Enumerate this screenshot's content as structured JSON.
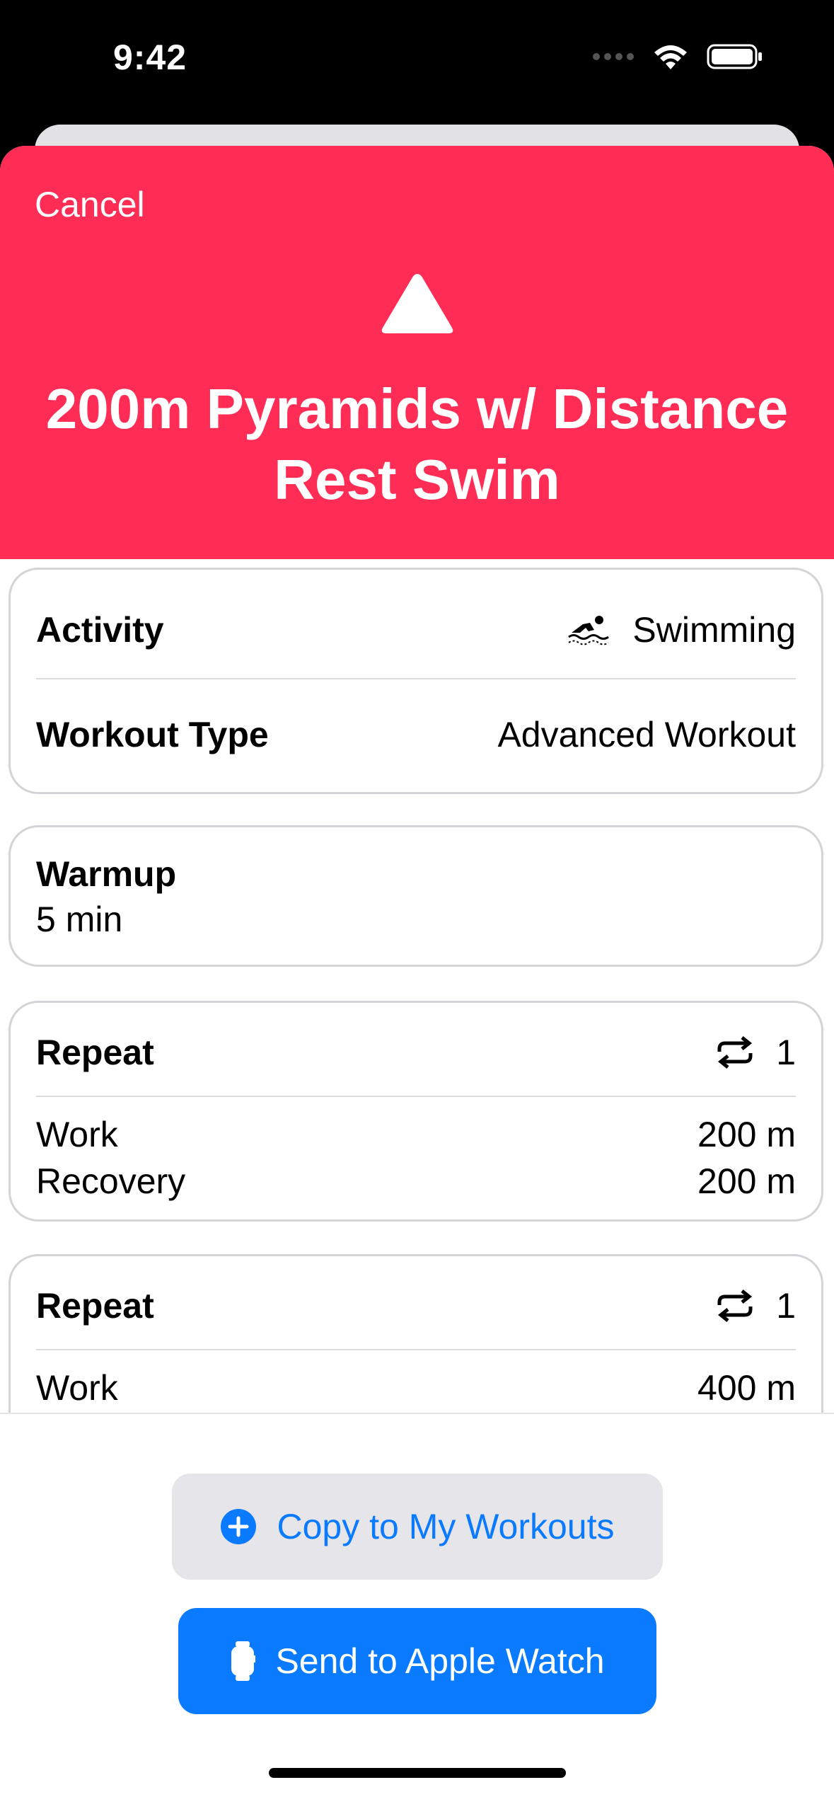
{
  "status_bar": {
    "time": "9:42"
  },
  "header": {
    "cancel_label": "Cancel",
    "title": "200m Pyramids w/ Distance Rest Swim",
    "icon": "triangle-icon",
    "color": "#ff2d55"
  },
  "summary": {
    "activity_label": "Activity",
    "activity_value": "Swimming",
    "activity_icon": "swimming-icon",
    "workout_type_label": "Workout Type",
    "workout_type_value": "Advanced Workout"
  },
  "warmup": {
    "label": "Warmup",
    "value": "5 min"
  },
  "repeats": [
    {
      "label": "Repeat",
      "count": "1",
      "icon": "repeat-icon",
      "steps": [
        {
          "label": "Work",
          "value": "200 m"
        },
        {
          "label": "Recovery",
          "value": "200 m"
        }
      ]
    },
    {
      "label": "Repeat",
      "count": "1",
      "icon": "repeat-icon",
      "steps": [
        {
          "label": "Work",
          "value": "400 m"
        }
      ]
    }
  ],
  "actions": {
    "copy_label": "Copy to My Workouts",
    "copy_icon": "plus-circle-icon",
    "send_label": "Send to Apple Watch",
    "send_icon": "watch-icon",
    "accent": "#0a7aff"
  }
}
